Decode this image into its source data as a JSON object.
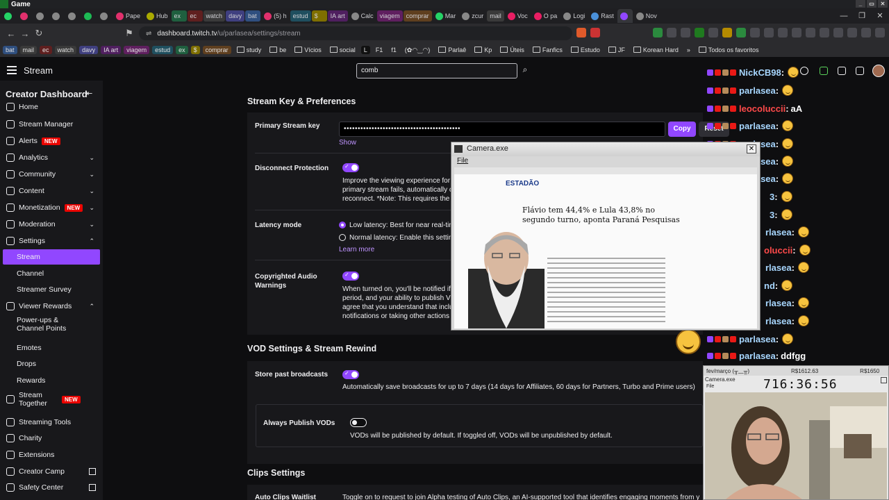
{
  "window": {
    "title": "Game"
  },
  "tabs": [
    {
      "label": "",
      "color": "#25d366"
    },
    {
      "label": "",
      "color": "#e1306c"
    },
    {
      "label": "",
      "color": "#888888"
    },
    {
      "label": "",
      "color": "#888888"
    },
    {
      "label": "",
      "color": "#888888"
    },
    {
      "label": "",
      "color": "#1db954"
    },
    {
      "label": "",
      "color": "#888888"
    },
    {
      "label": "Pape",
      "color": "#e1306c"
    },
    {
      "label": "Hub",
      "color": "#aaaa00"
    },
    {
      "label": "ex",
      "color": "#1f5f3f",
      "group": true
    },
    {
      "label": "ec",
      "color": "#5f1f1f",
      "group": true
    },
    {
      "label": "watch",
      "color": "#3a3a3a",
      "group": true
    },
    {
      "label": "davy",
      "color": "#3f3f7f",
      "group": true
    },
    {
      "label": "bat",
      "color": "#2f4f7f",
      "group": true
    },
    {
      "label": "(5) h",
      "color": "#e1306c"
    },
    {
      "label": "estud",
      "color": "#1f4f5f",
      "group": true
    },
    {
      "label": "$",
      "color": "#7f6f00",
      "group": true
    },
    {
      "label": "IA art",
      "color": "#4f1f5f",
      "group": true
    },
    {
      "label": "Calc",
      "color": "#888888"
    },
    {
      "label": "viagem",
      "color": "#5f1f5f",
      "group": true
    },
    {
      "label": "comprar",
      "color": "#5f3f1f",
      "group": true
    },
    {
      "label": "Mar",
      "color": "#25d366"
    },
    {
      "label": "zcur",
      "color": "#888888"
    },
    {
      "label": "mail",
      "color": "#3a3a3a",
      "group": true
    },
    {
      "label": "Voc",
      "color": "#e91e63"
    },
    {
      "label": "O pa",
      "color": "#e91e63"
    },
    {
      "label": "Logi",
      "color": "#888888"
    },
    {
      "label": "Rast",
      "color": "#4a90d9"
    },
    {
      "label": "",
      "color": "#9147ff",
      "active": true
    },
    {
      "label": "Nov",
      "color": "#888888"
    }
  ],
  "address": {
    "domain": "dashboard.twitch.tv",
    "path": "/u/parlasea/settings/stream"
  },
  "bookmarks": [
    {
      "label": "bat",
      "color": "#2f4f7f"
    },
    {
      "label": "mail",
      "color": "#3a3a3a"
    },
    {
      "label": "ec",
      "color": "#5f1f1f"
    },
    {
      "label": "watch",
      "color": "#3a3a3a"
    },
    {
      "label": "davy",
      "color": "#3f3f7f"
    },
    {
      "label": "IA art",
      "color": "#4f1f5f"
    },
    {
      "label": "viagem",
      "color": "#5f1f5f"
    },
    {
      "label": "estud",
      "color": "#1f4f5f"
    },
    {
      "label": "ex",
      "color": "#1f5f3f"
    },
    {
      "label": "$",
      "color": "#7f6f00"
    },
    {
      "label": "comprar",
      "color": "#5f3f1f"
    },
    {
      "label": "study",
      "folder": true
    },
    {
      "label": "be",
      "folder": true
    },
    {
      "label": "Vícios",
      "folder": true
    },
    {
      "label": "social",
      "folder": true
    },
    {
      "label": "L",
      "color": "#111111"
    },
    {
      "label": "F1"
    },
    {
      "label": "f1"
    },
    {
      "label": "(✿◠‿◠)"
    },
    {
      "label": "Parlaê",
      "folder": true
    },
    {
      "label": "Kp",
      "folder": true
    },
    {
      "label": "Úteis",
      "folder": true
    },
    {
      "label": "Fanfics",
      "folder": true
    },
    {
      "label": "Estudo",
      "folder": true
    },
    {
      "label": "JF",
      "folder": true
    },
    {
      "label": "Korean Hard",
      "folder": true
    },
    {
      "label": "»"
    },
    {
      "label": "Todos os favoritos",
      "folder": true
    }
  ],
  "topnav": {
    "title": "Stream",
    "search_value": "comb"
  },
  "sidebar": {
    "header": "Creator Dashboard",
    "new_badge": "NEW",
    "items": [
      {
        "label": "Home"
      },
      {
        "label": "Stream Manager"
      },
      {
        "label": "Alerts",
        "badge": "NEW"
      },
      {
        "label": "Analytics",
        "chevron": "down"
      },
      {
        "label": "Community",
        "chevron": "down"
      },
      {
        "label": "Content",
        "chevron": "down"
      },
      {
        "label": "Monetization",
        "badge": "NEW",
        "chevron": "down"
      },
      {
        "label": "Moderation",
        "chevron": "down"
      },
      {
        "label": "Settings",
        "chevron": "up"
      },
      {
        "label": "Stream",
        "sub": true,
        "active": true
      },
      {
        "label": "Channel",
        "sub": true
      },
      {
        "label": "Streamer Survey",
        "sub": true
      },
      {
        "label": "Viewer Rewards",
        "chevron": "up"
      },
      {
        "label": "Power-ups & Channel Points",
        "sub": true
      },
      {
        "label": "Emotes",
        "sub": true
      },
      {
        "label": "Drops",
        "sub": true
      },
      {
        "label": "Rewards",
        "sub": true
      },
      {
        "label": "Stream Together",
        "badge": "NEW"
      },
      {
        "label": "Streaming Tools"
      },
      {
        "label": "Charity"
      },
      {
        "label": "Extensions"
      },
      {
        "label": "Creator Camp",
        "external": true
      },
      {
        "label": "Safety Center",
        "external": true
      }
    ]
  },
  "stream_key": {
    "section_title": "Stream Key & Preferences",
    "primary_label": "Primary Stream key",
    "key_value": "••••••••••••••••••••••••••••••••••••••••••",
    "copy_label": "Copy",
    "reset_label": "Reset",
    "show_label": "Show",
    "disconnect_label": "Disconnect Protection",
    "disconnect_text1": "Improve the viewing experience for",
    "disconnect_text2": "primary stream fails, automatically c",
    "disconnect_text3": "reconnect. *Note: This requires the",
    "latency_label": "Latency mode",
    "low_latency": "Low latency: Best for near real-tin",
    "normal_latency": "Normal latency: Enable this settin",
    "learn_more": "Learn more",
    "copyright_label": "Copyrighted Audio Warnings",
    "copyright_text1": "When turned on, you'll be notified if",
    "copyright_text2": "period, and your ability to publish VO",
    "copyright_text3": "agree that you understand that inclu",
    "copyright_text4": "notifications or taking other actions"
  },
  "vod": {
    "section_title": "VOD Settings & Stream Rewind",
    "store_label": "Store past broadcasts",
    "store_text": "Automatically save broadcasts for up to 7 days (14 days for Affiliates, 60 days for Partners, Turbo and Prime users)",
    "publish_label": "Always Publish VODs",
    "publish_text": "VODs will be published by default. If toggled off, VODs will be unpublished by default."
  },
  "clips": {
    "section_title": "Clips Settings",
    "auto_label": "Auto Clips Waitlist",
    "auto_text": "Toggle on to request to join Alpha testing of Auto Clips, an AI-supported tool that identifies engaging moments from y"
  },
  "chat": {
    "messages": [
      {
        "user": "NickCB98",
        "msg": "",
        "emote": true
      },
      {
        "user": "parlasea",
        "msg": "",
        "emote": true
      },
      {
        "user": "leocoluccii",
        "msg": "aA",
        "red": true
      },
      {
        "user": "parlasea",
        "msg": "",
        "emote": true
      },
      {
        "user": "parlasea",
        "msg": "",
        "emote": true
      },
      {
        "user": "parlasea",
        "msg": "",
        "emote": true
      },
      {
        "user": "parlasea",
        "msg": "",
        "emote": true
      },
      {
        "user": "3",
        "msg": "",
        "emote": true
      },
      {
        "user": "3",
        "msg": "",
        "emote": true
      },
      {
        "user": "rlasea",
        "msg": "",
        "emote": true
      },
      {
        "user": "oluccii",
        "msg": "",
        "emote": true,
        "red": true
      },
      {
        "user": "rlasea",
        "msg": "",
        "emote": true
      },
      {
        "user": "nd",
        "msg": "",
        "emote": true
      },
      {
        "user": "rlasea",
        "msg": "",
        "emote": true
      },
      {
        "user": "rlasea",
        "msg": "",
        "emote": true
      },
      {
        "user": "parlasea",
        "msg": "",
        "emote": true
      },
      {
        "user": "parlasea",
        "msg": "ddfgg"
      }
    ]
  },
  "camera_window": {
    "title": "Camera.exe",
    "menu_file": "File",
    "article_logo": "ESTADÃO",
    "article_headline": "Flávio tem 44,4% e Lula 43,8% no segundo turno, aponta Paraná Pesquisas"
  },
  "overlay2": {
    "label1": "fev/março (╥﹏╥)",
    "label2": "R$1612.63",
    "label3": "R$1650",
    "title": "Camera.exe",
    "menu": "File",
    "timer": "716:36:56"
  }
}
